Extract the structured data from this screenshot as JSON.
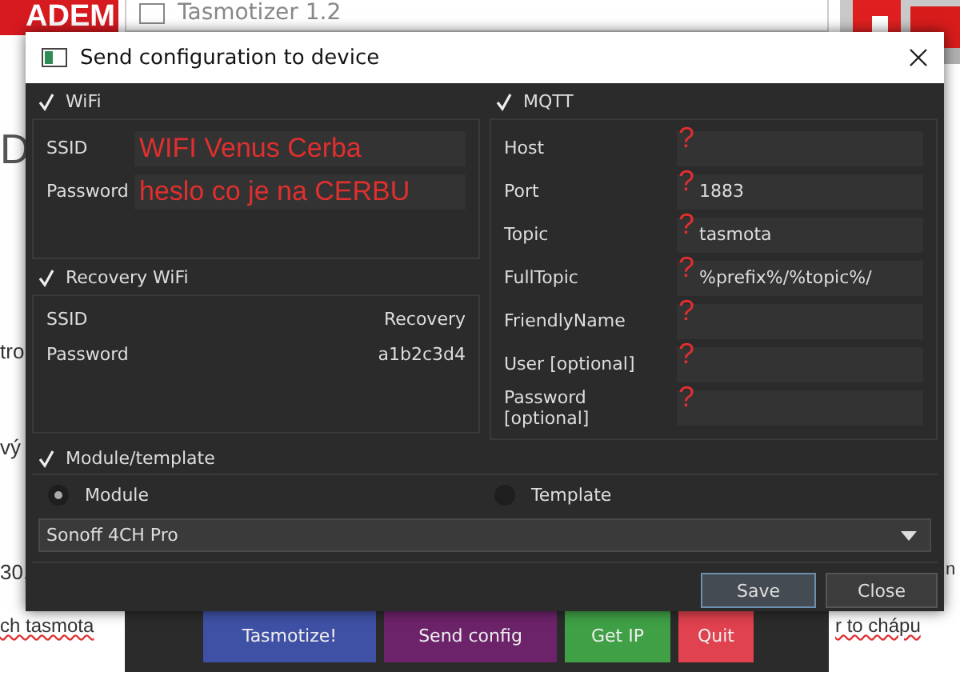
{
  "background_page": {
    "logo": "ADEM",
    "fragments": [
      {
        "text": "D"
      },
      {
        "text": "tro"
      },
      {
        "text": "vý"
      },
      {
        "text": "30,"
      },
      {
        "text": "ch tasmota"
      },
      {
        "text": "n"
      },
      {
        "text": "r to chápu"
      }
    ]
  },
  "back_window": {
    "title": "Tasmotizer 1.2",
    "buttons": [
      {
        "label": "Tasmotize!",
        "color": "#3f51a5"
      },
      {
        "label": "Send config",
        "color": "#6d2369"
      },
      {
        "label": "Get IP",
        "color": "#3fa046"
      },
      {
        "label": "Quit",
        "color": "#e0424f"
      }
    ]
  },
  "dialog": {
    "title": "Send configuration to device",
    "wifi": {
      "label": "WiFi",
      "checked": true,
      "fields": [
        {
          "label": "SSID",
          "annotation": "WIFI Venus Cerba"
        },
        {
          "label": "Password",
          "annotation": "heslo co je na CERBU"
        }
      ]
    },
    "recovery_wifi": {
      "label": "Recovery WiFi",
      "checked": true,
      "rows": [
        {
          "label": "SSID",
          "value": "Recovery"
        },
        {
          "label": "Password",
          "value": "a1b2c3d4"
        }
      ]
    },
    "mqtt": {
      "label": "MQTT",
      "checked": true,
      "fields": [
        {
          "label": "Host",
          "annotation": "?"
        },
        {
          "label": "Port",
          "value": "1883",
          "annotation": "?"
        },
        {
          "label": "Topic",
          "value": "tasmota",
          "annotation": "?"
        },
        {
          "label": "FullTopic",
          "value": "%prefix%/%topic%/",
          "annotation": "?"
        },
        {
          "label": "FriendlyName",
          "annotation": "?"
        },
        {
          "label": "User [optional]",
          "annotation": "?"
        },
        {
          "label": "Password [optional]",
          "annotation": "?"
        }
      ]
    },
    "module_template": {
      "label": "Module/template",
      "checked": true,
      "options": [
        {
          "label": "Module",
          "selected": true
        },
        {
          "label": "Template",
          "selected": false
        }
      ],
      "dropdown": "Sonoff 4CH Pro"
    },
    "buttons": [
      {
        "label": "Save",
        "focused": true
      },
      {
        "label": "Close",
        "focused": false
      }
    ]
  }
}
